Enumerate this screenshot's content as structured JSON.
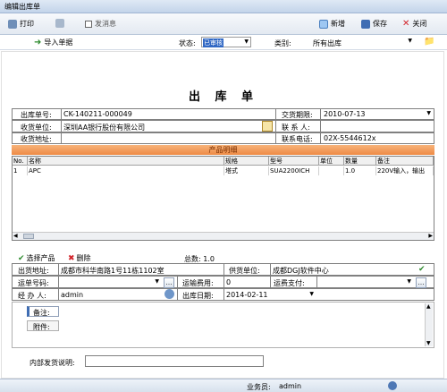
{
  "window": {
    "title": "编辑出库单"
  },
  "toolbar": {
    "print": "打印",
    "message": "发消息",
    "new": "新增",
    "save": "保存",
    "close": "关闭"
  },
  "subbar": {
    "import": "导入单据",
    "status_label": "状态:",
    "status_value": "已审核",
    "category_label": "类别:",
    "category_value": "所有出库"
  },
  "doc": {
    "title": "出 库 单",
    "order_no_label": "出库单号:",
    "order_no": "CK-140211-000049",
    "due_label": "交货期限:",
    "due": "2010-07-13",
    "receiver_label": "收货单位:",
    "receiver": "深圳AA银行股份有限公司",
    "contact_label": "联 系 人:",
    "contact": "",
    "address_label": "收货地址:",
    "address": "",
    "phone_label": "联系电话:",
    "phone": "02X-5544612x",
    "detail_header": "产品明细",
    "columns": [
      "No.",
      "名称",
      "规格",
      "型号",
      "单位",
      "数量",
      "备注"
    ],
    "rows": [
      [
        "1",
        "APC",
        "塔式",
        "SUA2200ICH",
        "",
        "1.0",
        "220V输入，输出"
      ]
    ]
  },
  "actions": {
    "select": "选择产品",
    "delete": "删除",
    "total": "总数: 1.0"
  },
  "bottom": {
    "ship_addr_label": "出货地址:",
    "ship_addr": "成都市科华南路1号11栋1102室",
    "supplier_label": "供货单位:",
    "supplier": "成都DGJ软件中心",
    "waybill_label": "运单号码:",
    "waybill": "",
    "freight_label": "运输费用:",
    "freight": "0",
    "pay_label": "运费支付:",
    "pay": "",
    "handler_label": "经 办 人:",
    "handler": "admin",
    "date_label": "出库日期:",
    "date": "2014-02-11",
    "remark_tab": "备注:",
    "attach_tab": "附件:",
    "internal_label": "内部发货说明:",
    "internal": ""
  },
  "status": {
    "clerk_label": "业务员:",
    "clerk": "admin"
  }
}
